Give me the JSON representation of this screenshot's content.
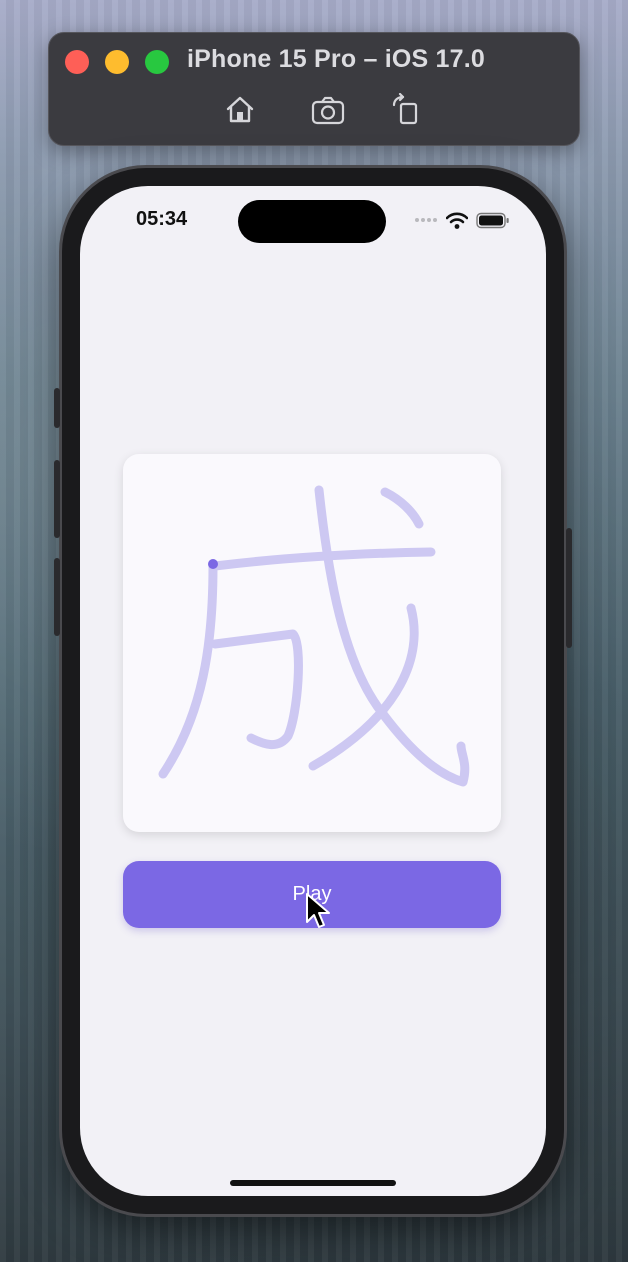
{
  "simulator": {
    "title": "iPhone 15 Pro – iOS 17.0",
    "toolbar": {
      "home_icon": "home-icon",
      "screenshot_icon": "camera-icon",
      "rotate_icon": "rotate-icon"
    }
  },
  "status_bar": {
    "time": "05:34"
  },
  "card": {
    "character": "成",
    "stroke_color": "#cdc8f2",
    "start_dot_color": "#7b68e4"
  },
  "play_button": {
    "label": "Play",
    "color": "#7b68e4"
  },
  "colors": {
    "screen_bg": "#f2f1f6",
    "card_bg": "#faf9fd"
  }
}
